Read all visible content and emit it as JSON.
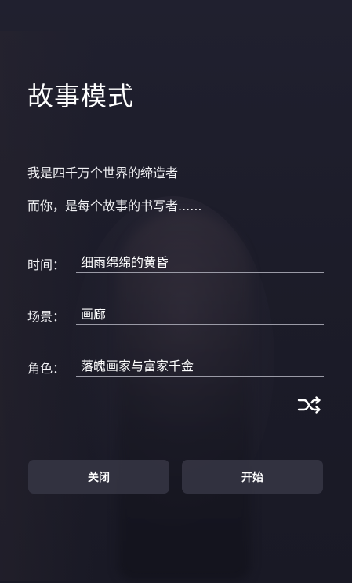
{
  "title": "故事模式",
  "intro": {
    "line1": "我是四千万个世界的缔造者",
    "line2": "而你，是每个故事的书写者......"
  },
  "fields": {
    "time": {
      "label": "时间：",
      "value": "细雨绵绵的黄昏"
    },
    "scene": {
      "label": "场景：",
      "value": "画廊"
    },
    "role": {
      "label": "角色：",
      "value": "落魄画家与富家千金"
    }
  },
  "shuffle": {
    "icon": "shuffle-icon"
  },
  "buttons": {
    "close_label": "关闭",
    "start_label": "开始"
  },
  "colors": {
    "background": "#1c1c2a",
    "button_bg": "#343442",
    "text": "#ffffff",
    "underline": "#9a9aa6"
  }
}
